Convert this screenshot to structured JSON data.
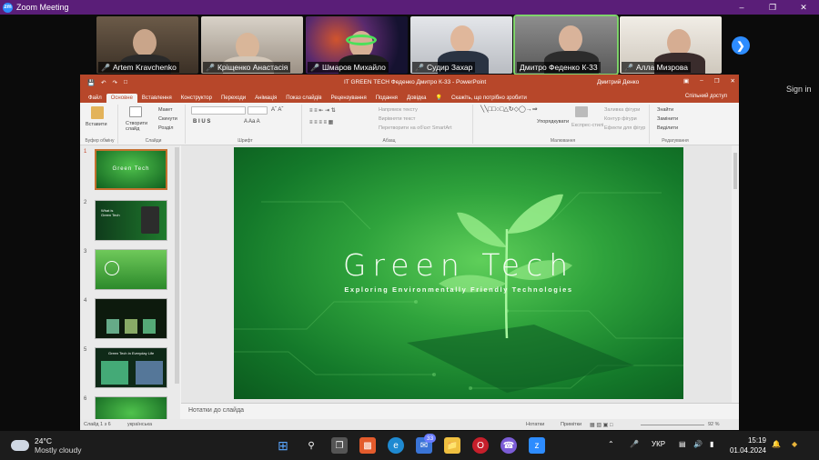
{
  "zoom": {
    "window_title": "Zoom Meeting",
    "sign_in": "Sign in"
  },
  "participants": [
    {
      "name": "Artem Kravchenko"
    },
    {
      "name": "Кріщенко Анастасія"
    },
    {
      "name": "Шмаров Михайло"
    },
    {
      "name": "Судир Захар"
    },
    {
      "name": "Дмитро Феденко К-33"
    },
    {
      "name": "Алла Мизрова"
    }
  ],
  "ppt": {
    "window_title": "IT GREEN TECH Феденко Дмитро К-33  -  PowerPoint",
    "user_name": "Дмитрий Денко",
    "tabs": [
      "Файл",
      "Основне",
      "Вставлення",
      "Конструктор",
      "Переходи",
      "Анімація",
      "Показ слайдів",
      "Рецензування",
      "Подання",
      "Довідка"
    ],
    "tell_me": "Скажіть, що потрібно зробити",
    "share": "Спільний доступ",
    "groups": {
      "clipboard": "Буфер обміну",
      "slides": "Слайди",
      "font": "Шрифт",
      "paragraph": "Абзац",
      "drawing": "Малювання",
      "editing": "Редагування"
    },
    "buttons": {
      "paste": "Вставити",
      "new_slide": "Створити слайд",
      "layout": "Макет",
      "reset": "Скинути",
      "sections": "Розділ",
      "text_direction": "Напрямок тексту",
      "align_text": "Вирівняти текст",
      "smartart": "Перетворити на об'єкт SmartArt",
      "arrange": "Упорядкувати",
      "quick_styles": "Експрес-стилі",
      "shape_fill": "Заливка фігури",
      "shape_outline": "Контур фігури",
      "shape_effects": "Ефекти для фігур",
      "find": "Знайти",
      "replace": "Замінити",
      "select": "Виділити"
    },
    "slide": {
      "title": "Green Tech",
      "subtitle": "Exploring Environmentally Friendly Technologies"
    },
    "thumbnail_numbers": [
      "1",
      "2",
      "3",
      "4",
      "5",
      "6"
    ],
    "thumb2_text": "What is Green Tech",
    "thumb5_text": "Green Tech in Everyday Life",
    "notes_placeholder": "Нотатки до слайда",
    "status": {
      "slide_counter": "Слайд 1 з 6",
      "language": "українська",
      "notes": "Нотатки",
      "comments": "Примітки",
      "zoom": "92 %"
    }
  },
  "taskbar": {
    "temperature": "24°C",
    "weather": "Mostly cloudy",
    "badge_count": "33",
    "language": "УКР",
    "time": "15:19",
    "date": "01.04.2024"
  },
  "colors": {
    "zoom_bar": "#5a1e78",
    "ppt_accent": "#b7472a",
    "slide_green": "#2fa33c",
    "zoom_blue": "#2d8cff"
  }
}
